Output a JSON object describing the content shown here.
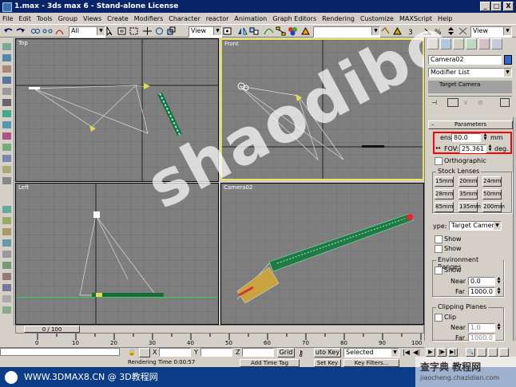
{
  "window": {
    "title": "1.max - 3ds max 6 - Stand-alone License",
    "minimize": "_",
    "maximize": "□",
    "close": "X"
  },
  "menu": [
    "File",
    "Edit",
    "Tools",
    "Group",
    "Views",
    "Create",
    "Modifiers",
    "Character",
    "reactor",
    "Animation",
    "Graph Editors",
    "Rendering",
    "Customize",
    "MAXScript",
    "Help"
  ],
  "toolbar": {
    "selection_filter": "All",
    "ref_coord": "View",
    "ref_coord2": "View"
  },
  "viewports": {
    "top": "Top",
    "front": "Front",
    "left": "Left",
    "camera": "Camera02"
  },
  "command_panel": {
    "object_name": "Camera02",
    "modifier_list": "Modifier List",
    "stack_item": "Target Camera",
    "parameters_title": "Parameters",
    "lens_label": "ens:",
    "lens_value": "80.0",
    "lens_unit": "mm",
    "fov_label": "FOV:",
    "fov_value": "25.361",
    "fov_unit": "deg.",
    "orthographic": "Orthographic",
    "stock_lenses_title": "Stock Lenses",
    "stock_lenses": [
      "15mm",
      "20mm",
      "24mm",
      "28mm",
      "35mm",
      "50mm",
      "85mm",
      "135mm",
      "200mm"
    ],
    "type_label": "ype:",
    "type_value": "Target Camer",
    "show_cone": "Show",
    "show_horizon": "Show",
    "env_ranges_title": "Environment Ranges",
    "env_show": "Show",
    "near_label": "Near",
    "near_value": "0.0",
    "far_label": "Far",
    "far_value": "1000.0",
    "clip_title": "Clipping Planes",
    "clip_label": "Clip",
    "clip_near_label": "Near",
    "clip_near_value": "1.0",
    "clip_far_label": "Far",
    "clip_far_value": "1000.0"
  },
  "timeline": {
    "frame": "0 / 100",
    "ticks": [
      "0",
      "10",
      "20",
      "30",
      "40",
      "50",
      "60",
      "70",
      "80",
      "90",
      "100"
    ]
  },
  "status": {
    "x_label": "X",
    "y_label": "Y",
    "z_label": "Z",
    "grid_label": "Grid",
    "autokey": "uto Key",
    "selected": "Selected",
    "setkey": "Set Key",
    "key_filters": "Key Filters...",
    "rendering_time": "Rendering Time 0:00:57",
    "add_time_tag": "Add Time Tag"
  },
  "watermark": "shaodibo",
  "banner": "WWW.3DMAX8.CN @ 3D教程网",
  "corner_logo": {
    "line1": "查字典 教程网",
    "line2": "jiaocheng.chazidian.com"
  },
  "colors": {
    "titlebar": "#0a246a",
    "viewport_bg": "#7f7f7f",
    "active_border": "#e8e060",
    "highlight_box": "#ff0000"
  }
}
